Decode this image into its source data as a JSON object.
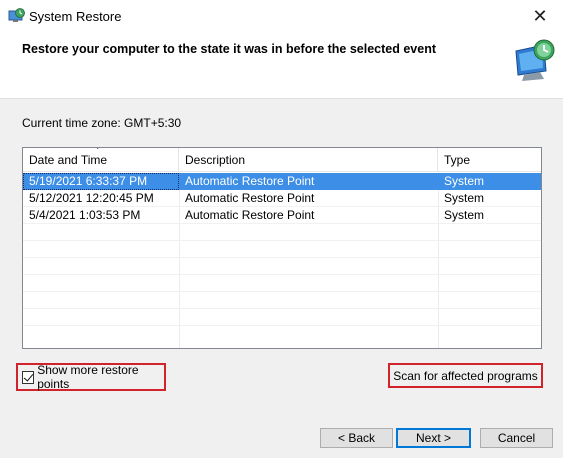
{
  "window": {
    "title": "System Restore",
    "close_glyph": "✕"
  },
  "header": {
    "heading": "Restore your computer to the state it was in before the selected event",
    "graphic_icon": "system-restore-monitor-icon"
  },
  "timezone_text": "Current time zone: GMT+5:30",
  "table": {
    "columns": [
      "Date and Time",
      "Description",
      "Type"
    ],
    "sort_indicator": "˅",
    "rows": [
      {
        "date": "5/19/2021 6:33:37 PM",
        "description": "Automatic Restore Point",
        "type": "System",
        "selected": true
      },
      {
        "date": "5/12/2021 12:20:45 PM",
        "description": "Automatic Restore Point",
        "type": "System",
        "selected": false
      },
      {
        "date": "5/4/2021 1:03:53 PM",
        "description": "Automatic Restore Point",
        "type": "System",
        "selected": false
      }
    ]
  },
  "show_more": {
    "label": "Show more restore points",
    "checked": true
  },
  "scan_button": "Scan for affected programs",
  "buttons": {
    "back": "< Back",
    "next": "Next >",
    "cancel": "Cancel"
  },
  "colors": {
    "selection": "#3d8ee6",
    "highlight_box": "#d0232b",
    "default_button_border": "#0078d7"
  }
}
